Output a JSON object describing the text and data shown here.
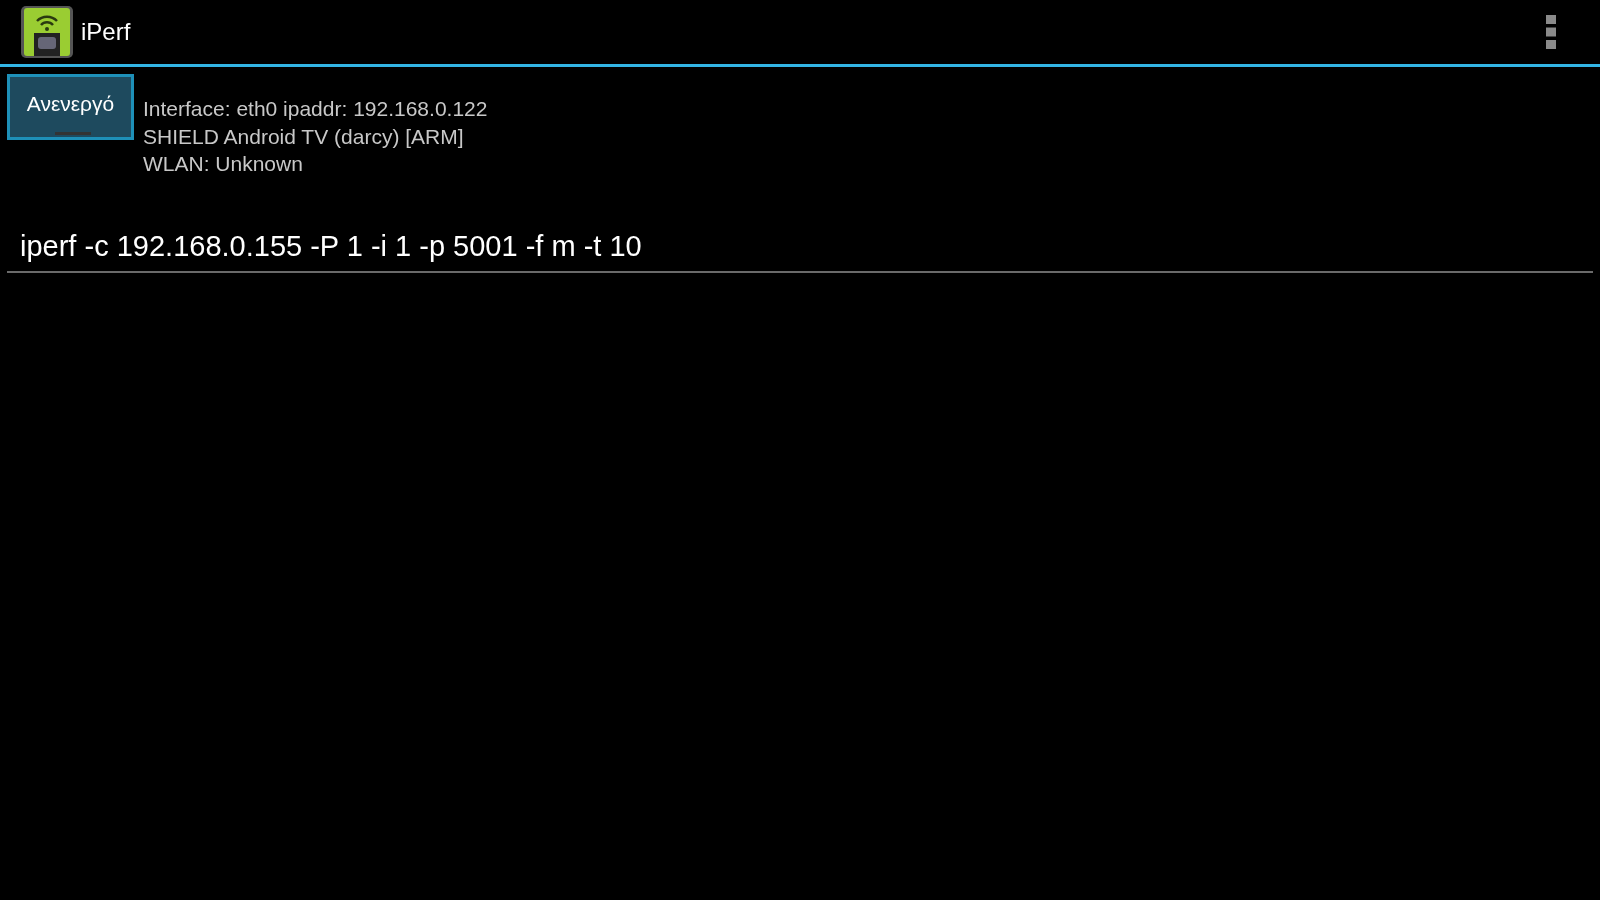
{
  "app_bar": {
    "title": "iPerf"
  },
  "toggle": {
    "label": "Ανενεργό",
    "on": false
  },
  "info_lines": [
    "Interface: eth0 ipaddr: 192.168.0.122",
    "SHIELD Android TV (darcy) [ARM]",
    "WLAN: Unknown"
  ],
  "command_field": {
    "value": "iperf -c 192.168.0.155 -P 1 -i 1 -p 5001 -f m -t 10"
  }
}
